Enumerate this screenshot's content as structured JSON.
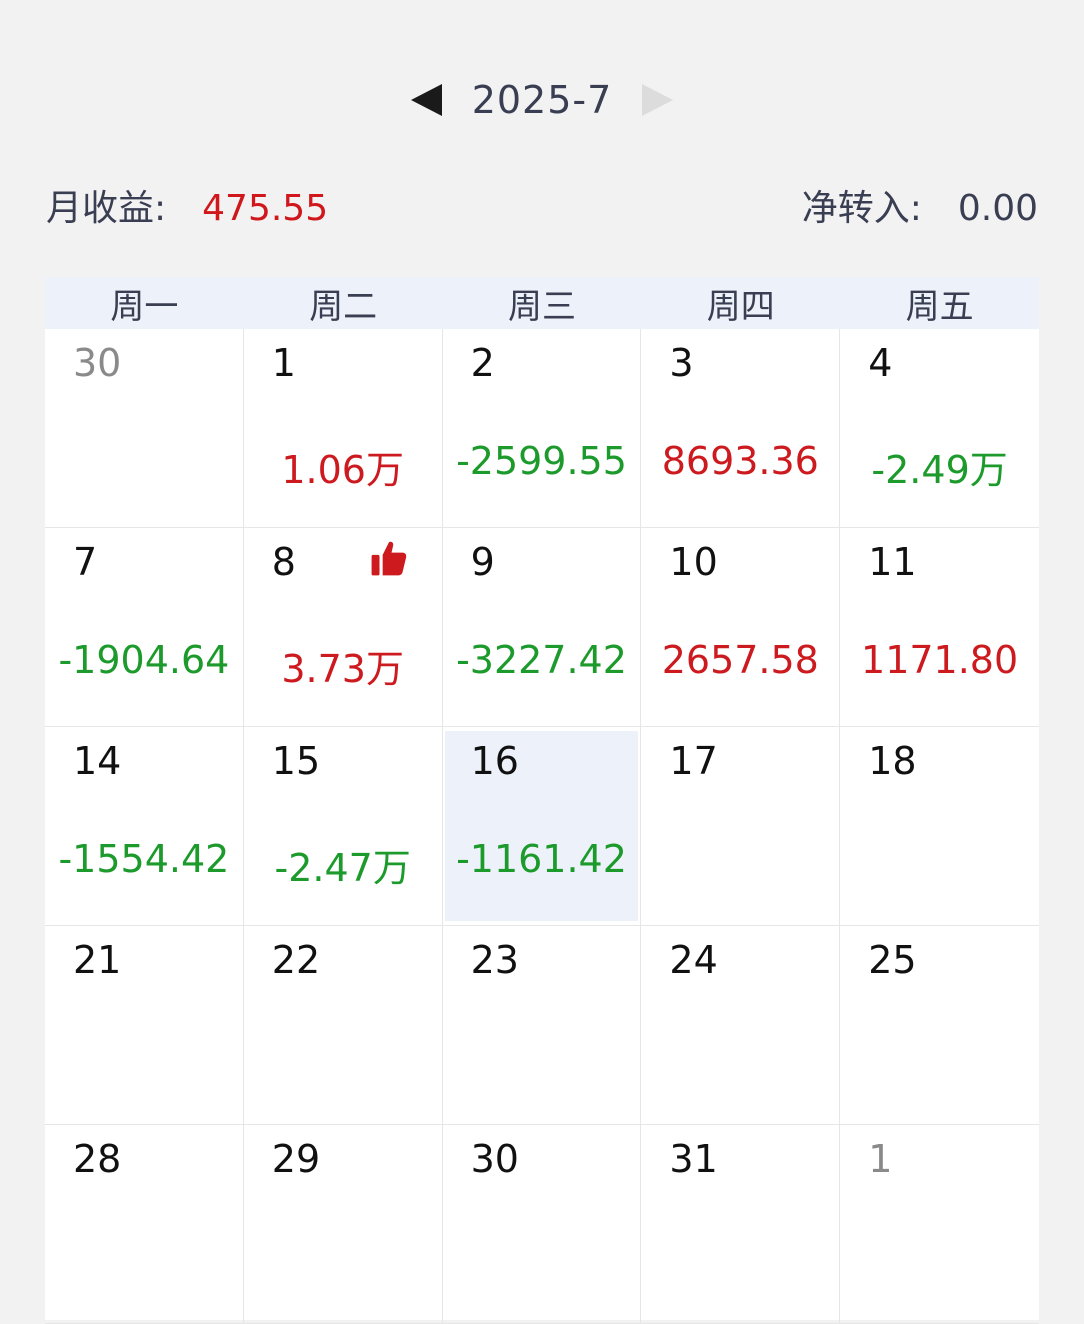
{
  "header": {
    "month": "2025-7"
  },
  "summary": {
    "monthly_label": "月收益:",
    "monthly_value": "475.55",
    "net_label": "净转入:",
    "net_value": "0.00"
  },
  "weekdays": [
    "周一",
    "周二",
    "周三",
    "周四",
    "周五"
  ],
  "days": [
    {
      "day": "30",
      "pnl": ""
    },
    {
      "day": "1",
      "pnl": "1.06万"
    },
    {
      "day": "2",
      "pnl": "-2599.55"
    },
    {
      "day": "3",
      "pnl": "8693.36"
    },
    {
      "day": "4",
      "pnl": "-2.49万"
    },
    {
      "day": "7",
      "pnl": "-1904.64"
    },
    {
      "day": "8",
      "pnl": "3.73万"
    },
    {
      "day": "9",
      "pnl": "-3227.42"
    },
    {
      "day": "10",
      "pnl": "2657.58"
    },
    {
      "day": "11",
      "pnl": "1171.80"
    },
    {
      "day": "14",
      "pnl": "-1554.42"
    },
    {
      "day": "15",
      "pnl": "-2.47万"
    },
    {
      "day": "16",
      "pnl": "-1161.42"
    },
    {
      "day": "17",
      "pnl": ""
    },
    {
      "day": "18",
      "pnl": ""
    },
    {
      "day": "21",
      "pnl": ""
    },
    {
      "day": "22",
      "pnl": ""
    },
    {
      "day": "23",
      "pnl": ""
    },
    {
      "day": "24",
      "pnl": ""
    },
    {
      "day": "25",
      "pnl": ""
    },
    {
      "day": "28",
      "pnl": ""
    },
    {
      "day": "29",
      "pnl": ""
    },
    {
      "day": "30",
      "pnl": ""
    },
    {
      "day": "31",
      "pnl": ""
    },
    {
      "day": "1",
      "pnl": ""
    }
  ],
  "colors": {
    "profit": "#cc1a1f",
    "loss": "#1c9a2b",
    "selected_bg": "#edf2fa"
  },
  "icons": {
    "best_day": "thumbs-up-icon"
  }
}
